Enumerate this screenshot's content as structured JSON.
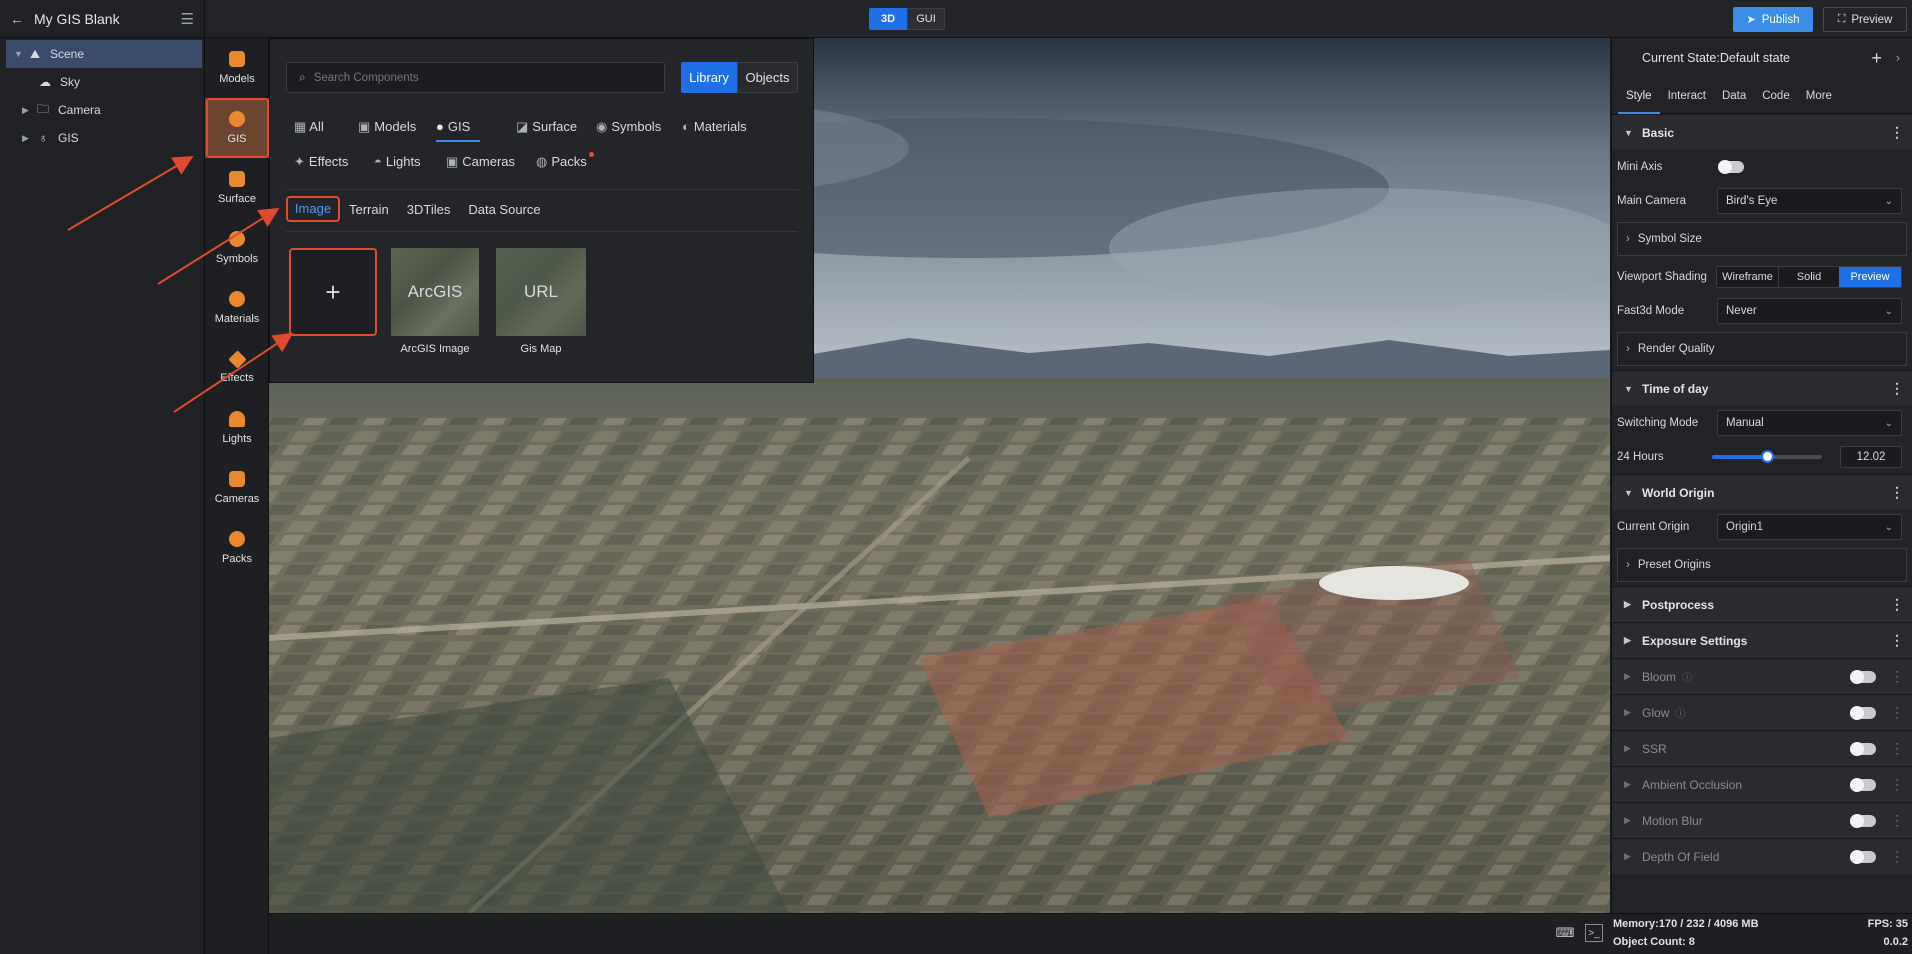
{
  "project": {
    "title": "My GIS Blank"
  },
  "topbar": {
    "mode_3d": "3D",
    "mode_gui": "GUI",
    "publish": "Publish",
    "preview": "Preview"
  },
  "scene_tree": [
    {
      "label": "Scene",
      "icon": "scene-icon"
    },
    {
      "label": "Sky",
      "icon": "sky-icon"
    },
    {
      "label": "Camera",
      "icon": "folder-icon"
    },
    {
      "label": "GIS",
      "icon": "gis-icon"
    }
  ],
  "categories": [
    "Models",
    "GIS",
    "Surface",
    "Symbols",
    "Materials",
    "Effects",
    "Lights",
    "Cameras",
    "Packs"
  ],
  "library": {
    "search_placeholder": "Search Components",
    "tab_library": "Library",
    "tab_objects": "Objects",
    "filters_row1": [
      "All",
      "Models",
      "GIS",
      "Surface",
      "Symbols",
      "Materials"
    ],
    "filters_row2": [
      "Effects",
      "Lights",
      "Cameras",
      "Packs"
    ],
    "subtabs": [
      "Image",
      "Terrain",
      "3DTiles",
      "Data Source"
    ],
    "cards": [
      {
        "thumb": "+",
        "label": ""
      },
      {
        "thumb": "ArcGIS",
        "label": "ArcGIS Image"
      },
      {
        "thumb": "URL",
        "label": "Gis Map"
      }
    ]
  },
  "right": {
    "state": "Current State:Default state",
    "tabs": [
      "Style",
      "Interact",
      "Data",
      "Code",
      "More"
    ],
    "basic": "Basic",
    "mini_axis": "Mini Axis",
    "main_camera": "Main Camera",
    "main_camera_value": "Bird's Eye",
    "symbol_size": "Symbol Size",
    "viewport_shading": "Viewport Shading",
    "shading_options": [
      "Wireframe",
      "Solid",
      "Preview"
    ],
    "fast3d": "Fast3d Mode",
    "fast3d_value": "Never",
    "render_quality": "Render Quality",
    "time_of_day": "Time of day",
    "switching_mode": "Switching Mode",
    "switching_value": "Manual",
    "hours_label": "24 Hours",
    "hours_value": "12.02",
    "hours_fraction": 0.5,
    "world_origin": "World Origin",
    "current_origin": "Current Origin",
    "current_origin_value": "Origin1",
    "preset_origins": "Preset Origins",
    "postprocess": "Postprocess",
    "exposure": "Exposure Settings",
    "effects": [
      "Bloom",
      "Glow",
      "SSR",
      "Ambient Occlusion",
      "Motion Blur",
      "Depth Of Field"
    ]
  },
  "status": {
    "memory": "Memory:170 / 232 / 4096 MB",
    "objects": "Object Count: 8",
    "fps": "FPS: 35",
    "version": "0.0.2"
  },
  "colors": {
    "accent": "#1f6fe6",
    "highlight": "#e04a2e",
    "category_icon": "#e9892f"
  }
}
